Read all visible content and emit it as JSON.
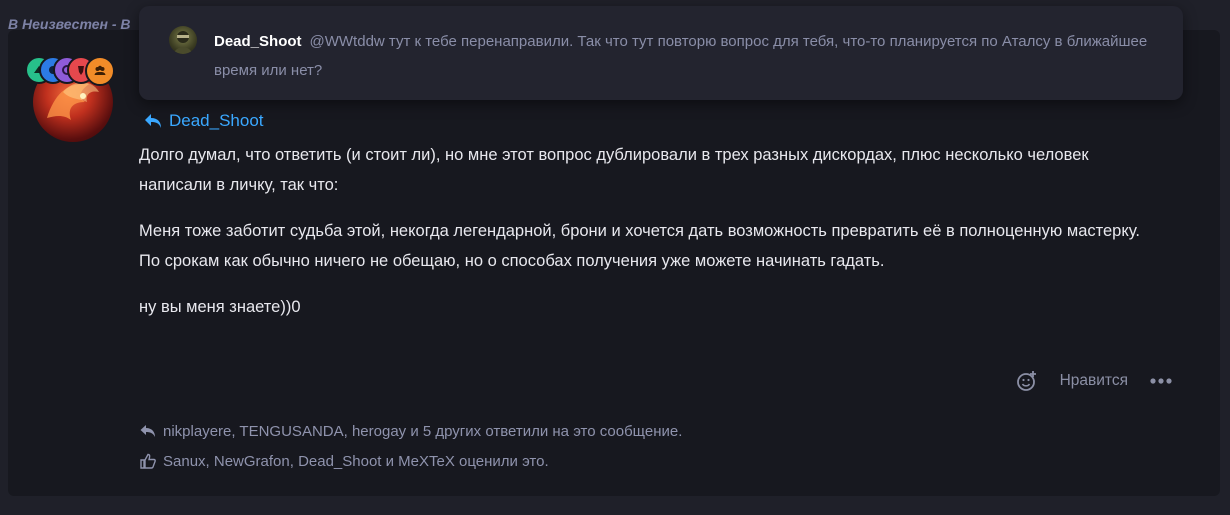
{
  "thread": {
    "prefix": "В",
    "forum": "Неизвестен - В"
  },
  "popup": {
    "author": "Dead_Shoot",
    "text": "@WWtddw тут к тебе перенаправили. Так что тут повторю вопрос для тебя, что-то планируется по Аталсу в ближайшее время или нет?"
  },
  "post": {
    "quote_author": "Dead_Shoot",
    "paragraphs": [
      "Долго думал, что ответить (и стоит ли), но мне этот вопрос дублировали в трех разных дискордах, плюс несколько человек написали в личку, так что:",
      "Меня тоже заботит судьба этой, некогда легендарной, брони и хочется дать возможность превратить её в полноценную мастерку.",
      "По срокам как обычно ничего не обещаю, но о способах получения уже можете начинать гадать.",
      "ну вы меня знаете))0"
    ],
    "like_label": "Нравится",
    "more_icon": "ellipsis-icon",
    "react_icon": "emoji-add-icon"
  },
  "footer": {
    "replies_text": "nikplayere, TENGUSANDA, herogay и 5 других ответили на это сообщение.",
    "likes_text": "Sanux, NewGrafon, Dead_Shoot и MeXTeX оценили это."
  },
  "colors": {
    "accent": "#3aa8ff",
    "badge_green": "#27c08a",
    "badge_blue": "#2c7be5",
    "badge_purple": "#8e5bd8",
    "badge_red": "#e5484d",
    "badge_orange": "#f28c28"
  }
}
